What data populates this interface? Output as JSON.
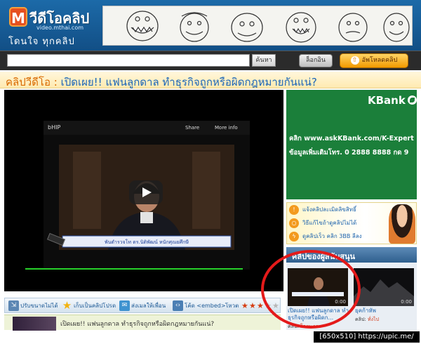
{
  "site": {
    "logo_letter": "M",
    "logo_title": "วีดีโอคลิป",
    "logo_url": "video.mthai.com",
    "logo_tagline": "โดนใจ ทุกคลิป"
  },
  "search": {
    "value": "",
    "placeholder": "",
    "button": "ค้นหา"
  },
  "header": {
    "login": "ล็อกอิน",
    "upload": "อัพโหลดคลิป",
    "upload_icon": "⇧"
  },
  "page": {
    "label": "คลิปวีดีโอ : ",
    "title": "เปิดเผย!! แฟนลูกดาล ทำธุรกิจถูกหรือผิดกฎหมายกันแน่?"
  },
  "player": {
    "channel": "bHIP",
    "share": "Share",
    "more_info": "More info",
    "caption": "พันตำรวจโท ดร.นิติพัฒน์ หนักศุณยศึกษี"
  },
  "tools": {
    "item1": "ปรับขนาดไม่ได้",
    "item2": "เก็บเป็นคลิปโปรด",
    "item3": "ส่งเมลให้เพื่อน",
    "item4": "โค้ด <embed>",
    "rating_label": "โหวต",
    "rating_value": 3,
    "rating_max": 5
  },
  "desc": {
    "text": "เปิดเผย!! แฟนลูกดาล ทำธุรกิจถูกหรือผิดกฎหมายกันแน่?"
  },
  "ad": {
    "brand": "KBank",
    "line1": "คลิก www.askKBank.com/K-Expert",
    "line2": "ข้อมูลเพิ่มเติมโทร. 0 2888 8888 กด 9"
  },
  "promo": {
    "items": [
      "แจ้งคลิปละเมิดลิขสิทธิ์",
      "วิธีแก้ไขถ้าดูคลิปไม่ได้",
      "ดูคลิปเร็ว คลิก 3BB ลีลง"
    ]
  },
  "sponsor": {
    "heading": "คลิปของผู้สนับสนุน",
    "clips": [
      {
        "time": "0:00",
        "title": "เปิดเผย!! แฟนลูกดาล ทำธุรกิจถูกหรือผิดก...",
        "author_label": "คลิป:",
        "author": "โดยนภา"
      },
      {
        "time": "0:00",
        "title": "ยุคก้าหัพ",
        "author_label": "คลิป:",
        "author": "ทั่งไป"
      }
    ]
  },
  "watermark": "[650x510] https://upic.me/",
  "colors": {
    "header_blue": "#1c6aa8",
    "title_orange": "#d96a00",
    "title_blue": "#1b66b8",
    "kbank_green": "#1b7f3a",
    "highlight_red": "#e41a1a",
    "progress_green": "#27d12b"
  }
}
